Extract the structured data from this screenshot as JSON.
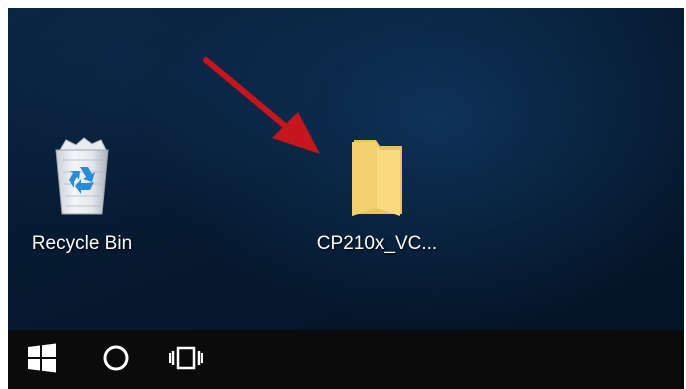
{
  "desktop": {
    "icons": [
      {
        "label": "Recycle Bin",
        "icon": "recycle-bin-icon"
      },
      {
        "label": "CP210x_VC...",
        "icon": "folder-icon"
      }
    ],
    "annotation": {
      "icon": "red-arrow-icon",
      "color": "#c4161c"
    }
  },
  "taskbar": {
    "buttons": [
      {
        "icon": "windows-start-icon"
      },
      {
        "icon": "cortana-search-icon"
      },
      {
        "icon": "task-view-icon"
      }
    ]
  }
}
